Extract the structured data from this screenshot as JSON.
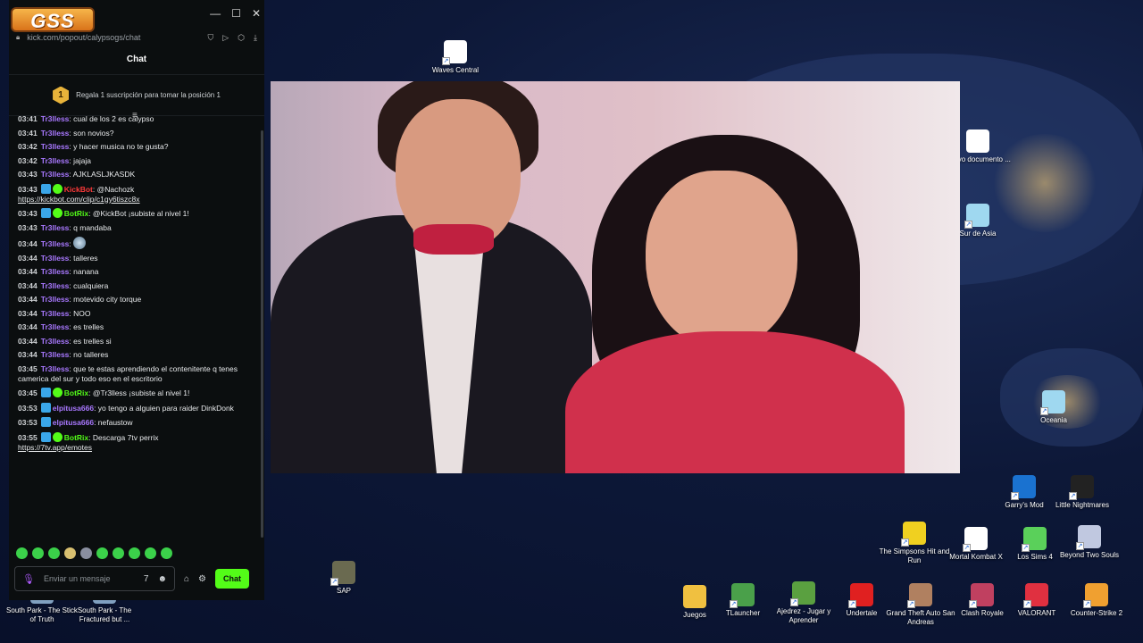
{
  "desktop": {
    "icons": [
      {
        "label": "Waves Central",
        "icon": "waves-icon",
        "color": "#ffffff"
      },
      {
        "label": "Nuevo documento ...",
        "icon": "document-icon",
        "color": "#ffffff"
      },
      {
        "label": "Sur de Asia",
        "icon": "image-icon",
        "color": "#9fd8f0"
      },
      {
        "label": "Oceania",
        "icon": "image-icon",
        "color": "#9fd8f0"
      },
      {
        "label": "Garry's Mod",
        "icon": "gmod-icon",
        "color": "#1a72d0"
      },
      {
        "label": "Little Nightmares",
        "icon": "little-nightmares-icon",
        "color": "#222222"
      },
      {
        "label": "The Simpsons Hit and Run",
        "icon": "simpsons-icon",
        "color": "#f0d020"
      },
      {
        "label": "Mortal Kombat X",
        "icon": "mk-icon",
        "color": "#ffffff"
      },
      {
        "label": "Los Sims 4",
        "icon": "sims-icon",
        "color": "#5ad05a"
      },
      {
        "label": "Beyond Two Souls",
        "icon": "beyond-icon",
        "color": "#c0c8e0"
      },
      {
        "label": "SAP",
        "icon": "sap-icon",
        "color": "#6a6a50"
      },
      {
        "label": "Juegos",
        "icon": "folder-icon",
        "color": "#f0c040"
      },
      {
        "label": "TLauncher",
        "icon": "tlauncher-icon",
        "color": "#4aa04a"
      },
      {
        "label": "Ajedrez - Jugar y Aprender",
        "icon": "chess-icon",
        "color": "#5aa040"
      },
      {
        "label": "Undertale",
        "icon": "undertale-icon",
        "color": "#e02020"
      },
      {
        "label": "Grand Theft Auto San Andreas",
        "icon": "gta-icon",
        "color": "#b08060"
      },
      {
        "label": "Clash Royale",
        "icon": "clash-royale-icon",
        "color": "#c04060"
      },
      {
        "label": "VALORANT",
        "icon": "valorant-icon",
        "color": "#e03040"
      },
      {
        "label": "Counter-Strike 2",
        "icon": "cs2-icon",
        "color": "#f0a030"
      },
      {
        "label": "South Park - The Stick of Truth",
        "icon": "southpark-icon",
        "color": "#80a0c0"
      },
      {
        "label": "South Park - The Fractured but ...",
        "icon": "southpark-icon",
        "color": "#80a0c0"
      }
    ]
  },
  "chat": {
    "logo_text": "GSS",
    "url": "kick.com/popout/calypsogs/chat",
    "header": "Chat",
    "promo_badge": "1",
    "promo_text": "Regala 1 suscripción para tomar la posición 1",
    "messages": [
      {
        "time": "03:41",
        "user": "Tr3lless",
        "text": ": cual de los 2 es calypso",
        "cls": "u-tr",
        "badges": []
      },
      {
        "time": "03:41",
        "user": "Tr3lless",
        "text": ": son novios?",
        "cls": "u-tr",
        "badges": []
      },
      {
        "time": "03:42",
        "user": "Tr3lless",
        "text": ": y hacer musica no te gusta?",
        "cls": "u-tr",
        "badges": []
      },
      {
        "time": "03:42",
        "user": "Tr3lless",
        "text": ": jajaja",
        "cls": "u-tr",
        "badges": []
      },
      {
        "time": "03:43",
        "user": "Tr3lless",
        "text": ": AJKLASLJKASDK",
        "cls": "u-tr",
        "badges": []
      },
      {
        "time": "03:43",
        "user": "KickBot",
        "text": ": @Nachozk",
        "link": "https://kickbot.com/clip/c1gy6tiszc8x",
        "cls": "u-kb",
        "badges": [
          "vip",
          "ver"
        ]
      },
      {
        "time": "03:43",
        "user": "BotRix",
        "text": ": @KickBot ¡subiste al nivel 1!",
        "cls": "u-bx",
        "badges": [
          "vip",
          "ver"
        ]
      },
      {
        "time": "03:43",
        "user": "Tr3lless",
        "text": ": q mandaba",
        "cls": "u-tr",
        "badges": []
      },
      {
        "time": "03:44",
        "user": "Tr3lless",
        "text": ":",
        "emote": true,
        "cls": "u-tr",
        "badges": []
      },
      {
        "time": "03:44",
        "user": "Tr3lless",
        "text": ": talleres",
        "cls": "u-tr",
        "badges": []
      },
      {
        "time": "03:44",
        "user": "Tr3lless",
        "text": ": nanana",
        "cls": "u-tr",
        "badges": []
      },
      {
        "time": "03:44",
        "user": "Tr3lless",
        "text": ": cualquiera",
        "cls": "u-tr",
        "badges": []
      },
      {
        "time": "03:44",
        "user": "Tr3lless",
        "text": ": motevido city torque",
        "cls": "u-tr",
        "badges": []
      },
      {
        "time": "03:44",
        "user": "Tr3lless",
        "text": ": NOO",
        "cls": "u-tr",
        "badges": []
      },
      {
        "time": "03:44",
        "user": "Tr3lless",
        "text": ": es trelles",
        "cls": "u-tr",
        "badges": []
      },
      {
        "time": "03:44",
        "user": "Tr3lless",
        "text": ": es trelles si",
        "cls": "u-tr",
        "badges": []
      },
      {
        "time": "03:44",
        "user": "Tr3lless",
        "text": ": no talleres",
        "cls": "u-tr",
        "badges": []
      },
      {
        "time": "03:45",
        "user": "Tr3lless",
        "text": ": que te estas aprendiendo el contenitente q tenes camerica del sur y todo eso en el escritorio",
        "cls": "u-tr",
        "badges": []
      },
      {
        "time": "03:45",
        "user": "BotRix",
        "text": ": @Tr3lless ¡subiste al nivel 1!",
        "cls": "u-bx",
        "badges": [
          "vip",
          "ver"
        ]
      },
      {
        "time": "03:53",
        "user": "elpitusa666",
        "text": ": yo tengo a alguien para raider DinkDonk",
        "cls": "u-el",
        "badges": [
          "vip"
        ]
      },
      {
        "time": "03:53",
        "user": "elpitusa666",
        "text": ": nefaustow",
        "cls": "u-el",
        "badges": [
          "vip"
        ]
      },
      {
        "time": "03:55",
        "user": "BotRix",
        "text": ": Descarga 7tv perrix",
        "link": "https://7tv.app/emotes",
        "cls": "u-bx",
        "badges": [
          "vip",
          "ver"
        ]
      }
    ],
    "input_placeholder": "Enviar un mensaje",
    "send_label": "Chat"
  }
}
